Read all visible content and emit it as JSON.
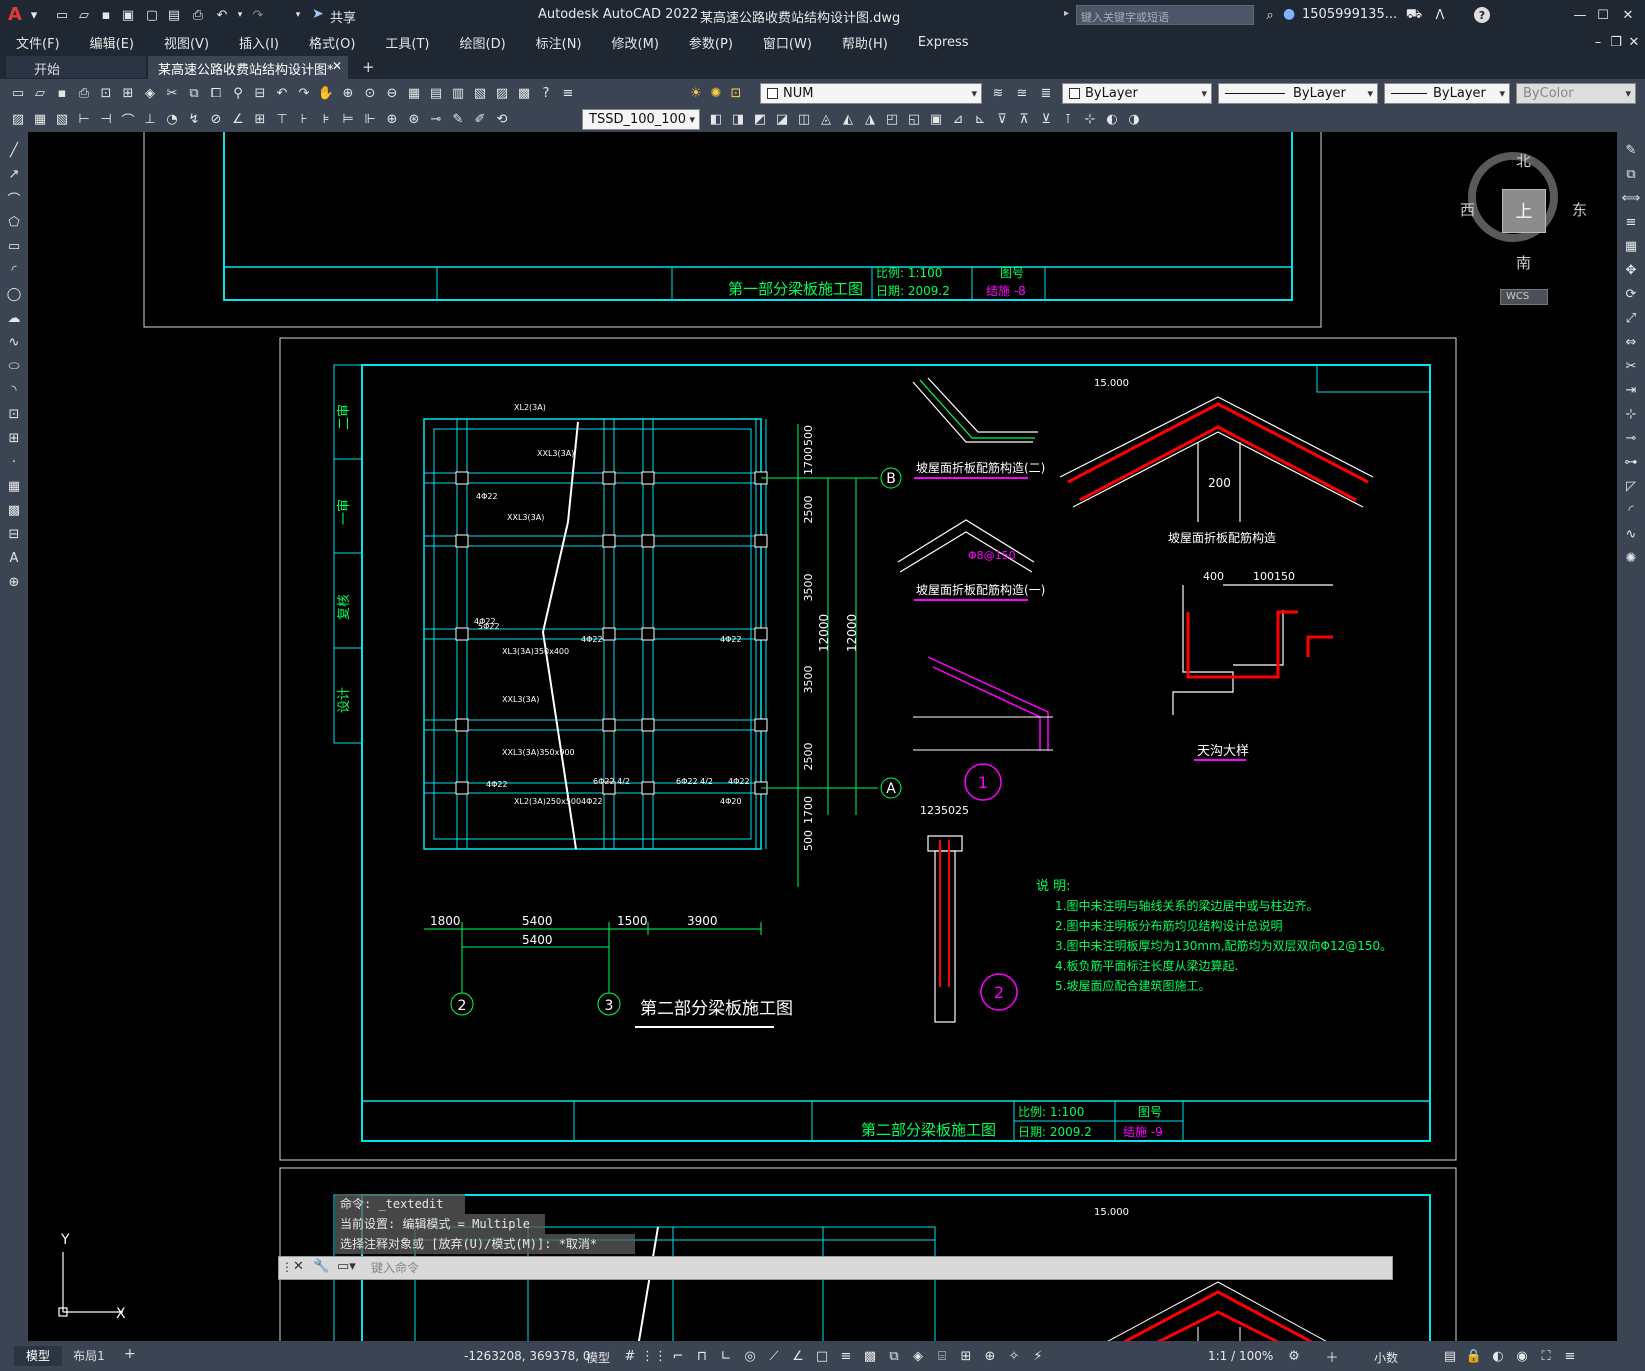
{
  "app": {
    "title": "Autodesk AutoCAD 2022",
    "filename": "某高速公路收费站结构设计图.dwg",
    "share_label": "共享",
    "search_placeholder": "键入关键字或短语",
    "user": "1505999135..."
  },
  "menu": [
    "文件(F)",
    "编辑(E)",
    "视图(V)",
    "插入(I)",
    "格式(O)",
    "工具(T)",
    "绘图(D)",
    "标注(N)",
    "修改(M)",
    "参数(P)",
    "窗口(W)",
    "帮助(H)",
    "Express"
  ],
  "tabs": {
    "start": "开始",
    "doc": "某高速公路收费站结构设计图*",
    "close": "✕",
    "add": "+"
  },
  "toolbar": {
    "layer": "NUM",
    "color": "ByLayer",
    "linetype": "ByLayer",
    "lineweight": "ByLayer",
    "plotstyle": "ByColor",
    "dimstyle": "TSSD_100_100"
  },
  "viewcube": {
    "north": "北",
    "south": "南",
    "east": "东",
    "west": "西",
    "top": "上",
    "wcs": "WCS"
  },
  "ucs": {
    "x": "X",
    "y": "Y"
  },
  "drawing": {
    "top_title": "第一部分梁板施工图",
    "top_scale": "比例: 1:100",
    "top_date": "日期: 2009.2",
    "top_drawno_label": "图号",
    "top_drawno": "结施 -8",
    "main_title": "第二部分梁板施工图",
    "main_scale": "比例: 1:100",
    "main_date": "日期: 2009.2",
    "drawno_label": "图号",
    "drawno": "结施 -9",
    "side_labels": [
      "二审",
      "一审",
      "复核",
      "设计"
    ],
    "detail1": "坡屋面折板配筋构造(二)",
    "detail2": "坡屋面折板配筋构造(一)",
    "detail3": "坡屋面折板配筋构造",
    "detail4": "天沟大样",
    "elev": "15.000",
    "notes_title": "说 明:",
    "notes": [
      "1.图中未注明与轴线关系的梁边居中或与柱边齐。",
      "2.图中未注明板分布筋均见结构设计总说明",
      "3.图中未注明板厚均为130mm,配筋均为双层双向Φ12@150。",
      "4.板负筋平面标注长度从梁边算起.",
      "5.坡屋面应配合建筑图施工。"
    ],
    "dims_bottom": [
      "1800",
      "5400",
      "1500",
      "3900"
    ],
    "dim_total": "5400",
    "dims_right": [
      "500",
      "1700",
      "2500",
      "3500",
      "3500",
      "2500",
      "1700",
      "500"
    ],
    "dim_12000": "12000",
    "axis_labels": [
      "B",
      "A",
      "2",
      "3"
    ],
    "circle_labels": [
      "1",
      "2"
    ]
  },
  "command": {
    "line1": "命令: _textedit",
    "line2": "当前设置: 编辑模式 = Multiple",
    "line3": "选择注释对象或 [放弃(U)/模式(M)]: *取消*",
    "placeholder": "键入命令"
  },
  "layout_tabs": [
    "模型",
    "布局1",
    "+"
  ],
  "status": {
    "coords": "-1263208, 369378, 0",
    "mode": "模型",
    "scale": "1:1 / 100%",
    "units": "小数"
  }
}
